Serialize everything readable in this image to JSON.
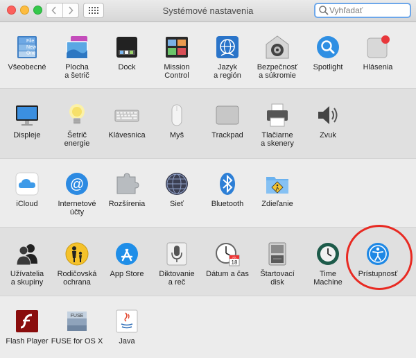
{
  "window": {
    "title": "Systémové nastavenia",
    "search_placeholder": "Vyhľadať"
  },
  "sections": [
    {
      "items": [
        {
          "id": "general",
          "label": "Všeobecné",
          "icon": "general-icon"
        },
        {
          "id": "desktop",
          "label": "Plocha\na šetrič",
          "icon": "desktop-icon"
        },
        {
          "id": "dock",
          "label": "Dock",
          "icon": "dock-icon"
        },
        {
          "id": "mission",
          "label": "Mission\nControl",
          "icon": "mission-control-icon"
        },
        {
          "id": "language",
          "label": "Jazyk\na región",
          "icon": "language-icon"
        },
        {
          "id": "security",
          "label": "Bezpečnosť\na súkromie",
          "icon": "security-icon"
        },
        {
          "id": "spotlight",
          "label": "Spotlight",
          "icon": "spotlight-icon"
        },
        {
          "id": "notifications",
          "label": "Hlásenia",
          "icon": "notifications-icon"
        }
      ]
    },
    {
      "items": [
        {
          "id": "displays",
          "label": "Displeje",
          "icon": "displays-icon"
        },
        {
          "id": "energy",
          "label": "Šetrič\nenergie",
          "icon": "energy-saver-icon"
        },
        {
          "id": "keyboard",
          "label": "Klávesnica",
          "icon": "keyboard-icon"
        },
        {
          "id": "mouse",
          "label": "Myš",
          "icon": "mouse-icon"
        },
        {
          "id": "trackpad",
          "label": "Trackpad",
          "icon": "trackpad-icon"
        },
        {
          "id": "printers",
          "label": "Tlačiarne\na skenery",
          "icon": "printer-icon"
        },
        {
          "id": "sound",
          "label": "Zvuk",
          "icon": "sound-icon"
        }
      ]
    },
    {
      "items": [
        {
          "id": "icloud",
          "label": "iCloud",
          "icon": "icloud-icon"
        },
        {
          "id": "internet",
          "label": "Internetové\núčty",
          "icon": "internet-accounts-icon"
        },
        {
          "id": "extensions",
          "label": "Rozšírenia",
          "icon": "extensions-icon"
        },
        {
          "id": "network",
          "label": "Sieť",
          "icon": "network-icon"
        },
        {
          "id": "bluetooth",
          "label": "Bluetooth",
          "icon": "bluetooth-icon"
        },
        {
          "id": "sharing",
          "label": "Zdieľanie",
          "icon": "sharing-icon"
        }
      ]
    },
    {
      "items": [
        {
          "id": "users",
          "label": "Užívatelia\na skupiny",
          "icon": "users-icon"
        },
        {
          "id": "parental",
          "label": "Rodičovská\nochrana",
          "icon": "parental-controls-icon"
        },
        {
          "id": "appstore",
          "label": "App Store",
          "icon": "app-store-icon"
        },
        {
          "id": "dictation",
          "label": "Diktovanie\na reč",
          "icon": "dictation-icon"
        },
        {
          "id": "datetime",
          "label": "Dátum a čas",
          "icon": "date-time-icon"
        },
        {
          "id": "startup",
          "label": "Štartovací\ndisk",
          "icon": "startup-disk-icon"
        },
        {
          "id": "timemachine",
          "label": "Time\nMachine",
          "icon": "time-machine-icon"
        },
        {
          "id": "accessibility",
          "label": "Prístupnosť",
          "icon": "accessibility-icon"
        }
      ]
    },
    {
      "items": [
        {
          "id": "flash",
          "label": "Flash Player",
          "icon": "flash-player-icon"
        },
        {
          "id": "fuse",
          "label": "FUSE for OS X",
          "icon": "fuse-icon"
        },
        {
          "id": "java",
          "label": "Java",
          "icon": "java-icon"
        }
      ]
    }
  ],
  "icon_texts": {
    "general": "File\nNew\nOne",
    "fuse": "FUSE",
    "calendar_month": "JÚL",
    "calendar_day": "18"
  },
  "colors": {
    "highlight_circle": "#e82a22",
    "search_focus": "#6da7ea"
  }
}
